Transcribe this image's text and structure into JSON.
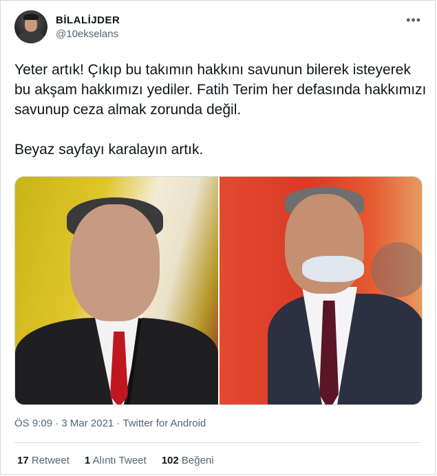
{
  "author": {
    "display_name": "BİLALİJDER",
    "handle": "@10ekselans"
  },
  "more_icon": "more-icon",
  "tweet": {
    "paragraph1": "Yeter artık! Çıkıp bu takımın hakkını savunun bilerek isteyerek bu akşam hakkımızı yediler. Fatih Terim her defasında hakkımızı savunup ceza almak zorunda değil.",
    "paragraph2": "Beyaz sayfayı karalayın artık."
  },
  "meta": {
    "time": "ÖS 9:09",
    "date": "3 Mar 2021",
    "source": "Twitter for Android",
    "separator": "·"
  },
  "stats": {
    "retweets_count": "17",
    "retweets_label": "Retweet",
    "quotes_count": "1",
    "quotes_label": "Alıntı Tweet",
    "likes_count": "102",
    "likes_label": "Beğeni"
  },
  "colors": {
    "text": "#0f1419",
    "muted": "#536471",
    "border": "#cfd9de"
  }
}
